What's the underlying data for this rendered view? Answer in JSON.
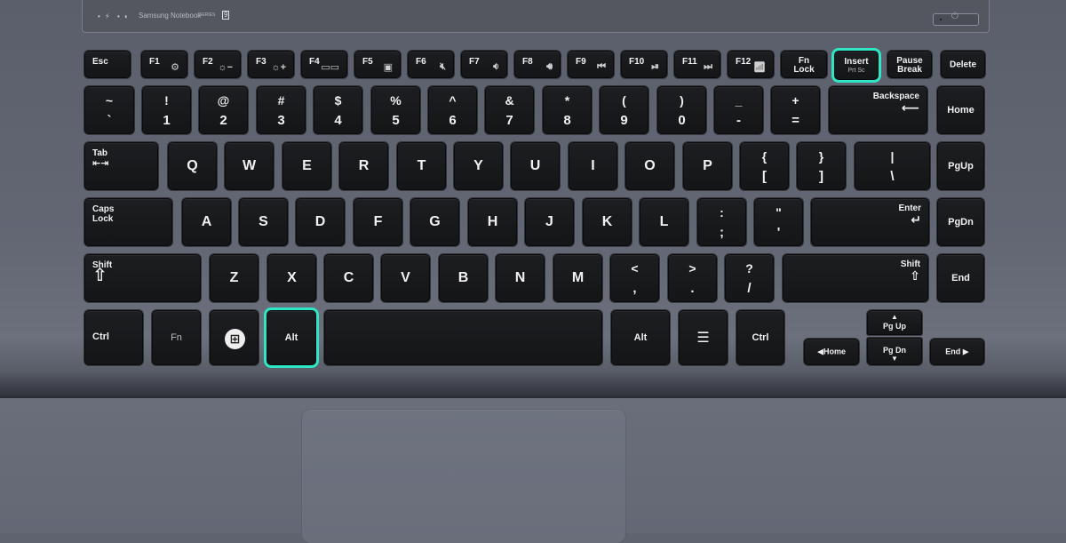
{
  "device": {
    "brand": "Samsung Notebook",
    "series_label": "SERIES",
    "series_number": "9",
    "indicators": [
      "•",
      "⚡",
      "•",
      "◐"
    ],
    "power_icon": "⏻"
  },
  "highlight_color": "#2ee6c4",
  "highlighted_keys": [
    "Insert",
    "Alt"
  ],
  "rows": {
    "function": [
      {
        "label": "Esc"
      },
      {
        "label": "F1",
        "icon": "⚙"
      },
      {
        "label": "F2",
        "icon": "☼−"
      },
      {
        "label": "F3",
        "icon": "☼+"
      },
      {
        "label": "F4",
        "icon": "▭▭"
      },
      {
        "label": "F5",
        "icon": "▣"
      },
      {
        "label": "F6",
        "icon": "🔇︎"
      },
      {
        "label": "F7",
        "icon": "🔉︎"
      },
      {
        "label": "F8",
        "icon": "🔊︎"
      },
      {
        "label": "F9",
        "icon": "⏮"
      },
      {
        "label": "F10",
        "icon": "⏯"
      },
      {
        "label": "F11",
        "icon": "⏭"
      },
      {
        "label": "F12",
        "icon": "📶︎"
      },
      {
        "label": "Fn",
        "label2": "Lock"
      },
      {
        "label": "Insert",
        "sub": "Prt Sc"
      },
      {
        "label": "Pause",
        "label2": "Break"
      },
      {
        "label": "Delete"
      }
    ],
    "number": [
      {
        "up": "~",
        "dn": "`"
      },
      {
        "up": "!",
        "dn": "1"
      },
      {
        "up": "@",
        "dn": "2"
      },
      {
        "up": "#",
        "dn": "3"
      },
      {
        "up": "$",
        "dn": "4"
      },
      {
        "up": "%",
        "dn": "5"
      },
      {
        "up": "^",
        "dn": "6"
      },
      {
        "up": "&",
        "dn": "7"
      },
      {
        "up": "*",
        "dn": "8"
      },
      {
        "up": "(",
        "dn": "9"
      },
      {
        "up": ")",
        "dn": "0"
      },
      {
        "up": "_",
        "dn": "-"
      },
      {
        "up": "+",
        "dn": "="
      },
      {
        "label": "Backspace",
        "glyph": "⟵"
      },
      {
        "label": "Home"
      }
    ],
    "qwerty": [
      {
        "label": "Tab",
        "glyph": "⇤⇥"
      },
      {
        "label": "Q"
      },
      {
        "label": "W"
      },
      {
        "label": "E"
      },
      {
        "label": "R"
      },
      {
        "label": "T"
      },
      {
        "label": "Y"
      },
      {
        "label": "U"
      },
      {
        "label": "I"
      },
      {
        "label": "O"
      },
      {
        "label": "P"
      },
      {
        "up": "{",
        "dn": "["
      },
      {
        "up": "}",
        "dn": "]"
      },
      {
        "up": "|",
        "dn": "\\"
      },
      {
        "label": "PgUp"
      }
    ],
    "home": [
      {
        "label": "Caps",
        "label2": "Lock"
      },
      {
        "label": "A"
      },
      {
        "label": "S"
      },
      {
        "label": "D"
      },
      {
        "label": "F"
      },
      {
        "label": "G"
      },
      {
        "label": "H"
      },
      {
        "label": "J"
      },
      {
        "label": "K"
      },
      {
        "label": "L"
      },
      {
        "up": ":",
        "dn": ";"
      },
      {
        "up": "\"",
        "dn": "'"
      },
      {
        "label": "Enter",
        "glyph": "↵"
      },
      {
        "label": "PgDn"
      }
    ],
    "shift": [
      {
        "label": "Shift",
        "glyph": "⇧"
      },
      {
        "label": "Z"
      },
      {
        "label": "X"
      },
      {
        "label": "C"
      },
      {
        "label": "V"
      },
      {
        "label": "B"
      },
      {
        "label": "N"
      },
      {
        "label": "M"
      },
      {
        "up": "<",
        "dn": ","
      },
      {
        "up": ">",
        "dn": "."
      },
      {
        "up": "?",
        "dn": "/"
      },
      {
        "label": "Shift",
        "glyph": "⇧"
      },
      {
        "label": "End"
      }
    ],
    "bottom": [
      {
        "label": "Ctrl"
      },
      {
        "label": "Fn"
      },
      {
        "label": "⊞"
      },
      {
        "label": "Alt"
      },
      {
        "label": ""
      },
      {
        "label": "Alt"
      },
      {
        "label": "☰"
      },
      {
        "label": "Ctrl"
      },
      {
        "label": "◀Home"
      },
      {
        "label": "Pg Up",
        "glyph": "▲"
      },
      {
        "label": "Pg Dn",
        "glyph": "▼"
      },
      {
        "label": "End ▶"
      }
    ]
  }
}
